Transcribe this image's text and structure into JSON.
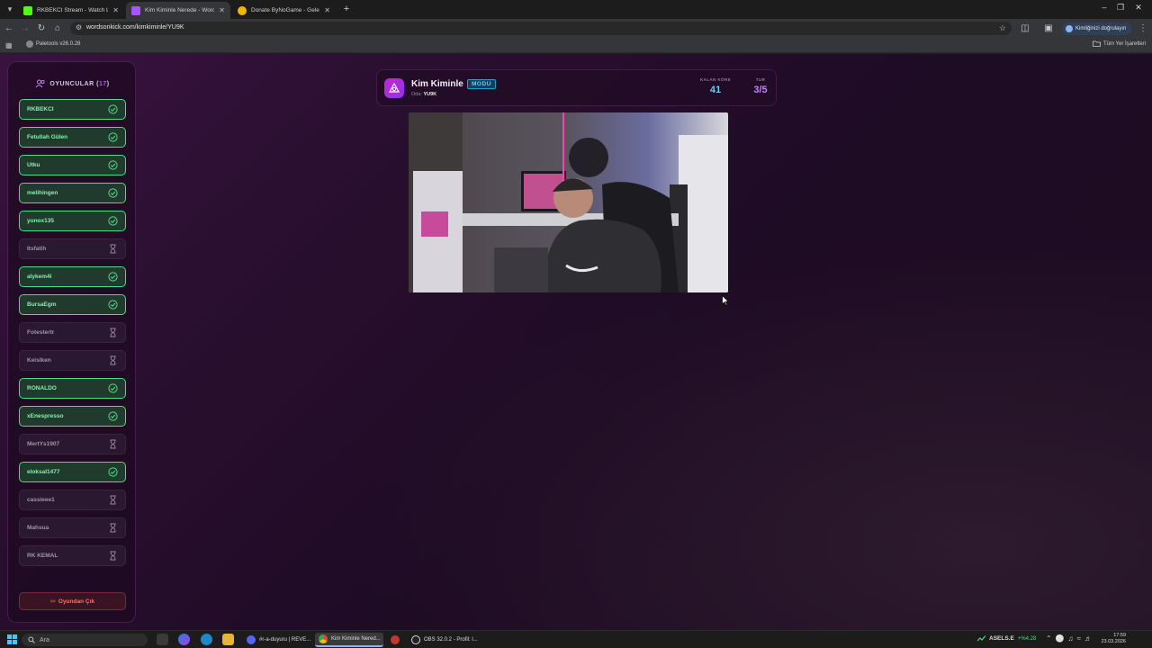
{
  "browser": {
    "tabs": [
      {
        "title": "RKBEKCI Stream - Watch Live o",
        "favicon_color": "#53fc18",
        "active": false
      },
      {
        "title": "Kim Kiminle Nerede - Words O",
        "favicon_color": "#a855f7",
        "active": true
      },
      {
        "title": "Donate ByNoGame - Gelen/Gid",
        "favicon_color": "#f5b400",
        "active": false
      }
    ],
    "url": "wordsonkick.com/kimkiminle/YU9K",
    "profile_label": "Kimliğinizi doğrulayın",
    "bookmark": "Paletools v26.0.28",
    "all_bookmarks": "Tüm Yer İşaretleri"
  },
  "players_panel": {
    "title": "OYUNCULAR",
    "count": "17",
    "players": [
      {
        "name": "RKBEKCI",
        "status": "done"
      },
      {
        "name": "Fetullah Gülen",
        "status": "done"
      },
      {
        "name": "Utku",
        "status": "done"
      },
      {
        "name": "melihingen",
        "status": "done"
      },
      {
        "name": "yunox135",
        "status": "done"
      },
      {
        "name": "Itsfatih",
        "status": "waiting"
      },
      {
        "name": "alykem4l",
        "status": "done"
      },
      {
        "name": "BursaEgm",
        "status": "done"
      },
      {
        "name": "Fotestertr",
        "status": "waiting"
      },
      {
        "name": "Keislken",
        "status": "waiting"
      },
      {
        "name": "RONALDO",
        "status": "done"
      },
      {
        "name": "xEnespresso",
        "status": "done"
      },
      {
        "name": "MertYs1907",
        "status": "waiting"
      },
      {
        "name": "eloksal1477",
        "status": "done"
      },
      {
        "name": "cassieee1",
        "status": "waiting"
      },
      {
        "name": "Mahsua",
        "status": "waiting"
      },
      {
        "name": "RK KEMAL",
        "status": "waiting"
      }
    ],
    "leave_label": "Oyundan Çık"
  },
  "game": {
    "title": "Kim Kiminle",
    "mode_badge": "MODU",
    "room_label": "Oda:",
    "room_code": "YU9K",
    "words_left_label": "KALAN KÖRE",
    "words_left": "41",
    "round_label": "TUR",
    "round": "3/5"
  },
  "taskbar": {
    "search_placeholder": "Ara",
    "apps": [
      {
        "label": "#r-a-duyuru | REVE...",
        "icon_color": "#5865f2",
        "active": false
      },
      {
        "label": "Kim Kiminle Nered...",
        "icon_color": "#4285f4",
        "active": true
      },
      {
        "label": "OBS 32.0.2 - Profil: l...",
        "icon_color": "#e0e0e0",
        "active": false
      }
    ],
    "stock_symbol": "ASELS.E",
    "stock_change": "+%4.28",
    "time": "17:59",
    "date": "23.03.2026"
  },
  "colors": {
    "accent": "#a855f7",
    "done": "#4ade80",
    "words": "#5fd3f3",
    "danger": "#f87171"
  }
}
